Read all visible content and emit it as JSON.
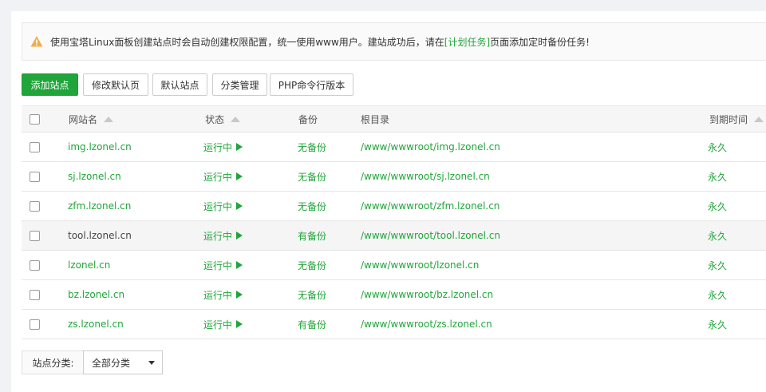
{
  "notice": {
    "text_before": "使用宝塔Linux面板创建站点时会自动创建权限配置，统一使用www用户。建站成功后，请在",
    "link": "[计划任务]",
    "text_after": "页面添加定时备份任务!"
  },
  "toolbar": {
    "add_site": "添加站点",
    "modify_default_page": "修改默认页",
    "default_site": "默认站点",
    "category_manage": "分类管理",
    "php_cli_version": "PHP命令行版本"
  },
  "table": {
    "headers": {
      "name": "网站名",
      "status": "状态",
      "backup": "备份",
      "root": "根目录",
      "expire": "到期时间"
    },
    "rows": [
      {
        "name": "img.lzonel.cn",
        "status": "运行中",
        "backup": "无备份",
        "root": "/www/wwwroot/img.lzonel.cn",
        "expire": "永久"
      },
      {
        "name": "sj.lzonel.cn",
        "status": "运行中",
        "backup": "无备份",
        "root": "/www/wwwroot/sj.lzonel.cn",
        "expire": "永久"
      },
      {
        "name": "zfm.lzonel.cn",
        "status": "运行中",
        "backup": "无备份",
        "root": "/www/wwwroot/zfm.lzonel.cn",
        "expire": "永久"
      },
      {
        "name": "tool.lzonel.cn",
        "status": "运行中",
        "backup": "有备份",
        "root": "/www/wwwroot/tool.lzonel.cn",
        "expire": "永久"
      },
      {
        "name": "lzonel.cn",
        "status": "运行中",
        "backup": "无备份",
        "root": "/www/wwwroot/lzonel.cn",
        "expire": "永久"
      },
      {
        "name": "bz.lzonel.cn",
        "status": "运行中",
        "backup": "无备份",
        "root": "/www/wwwroot/bz.lzonel.cn",
        "expire": "永久"
      },
      {
        "name": "zs.lzonel.cn",
        "status": "运行中",
        "backup": "有备份",
        "root": "/www/wwwroot/zs.lzonel.cn",
        "expire": "永久"
      }
    ]
  },
  "footer": {
    "category_label": "站点分类:",
    "category_selected": "全部分类"
  },
  "colors": {
    "accent": "#20a53a",
    "warning": "#f0ad4e"
  },
  "icons": {
    "notice": "warning-icon",
    "status": "play-icon",
    "sort": "sort-up-icon"
  }
}
